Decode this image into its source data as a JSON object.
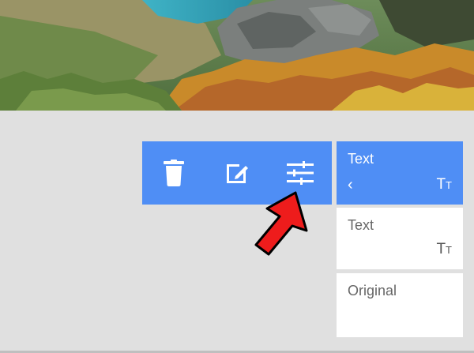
{
  "photo": {
    "icon": "landscape-photo"
  },
  "toolbar": {
    "color": "#4f8ef5",
    "buttons": [
      {
        "name": "delete",
        "icon": "trash-icon"
      },
      {
        "name": "edit",
        "icon": "edit-icon"
      },
      {
        "name": "adjust",
        "icon": "sliders-icon"
      }
    ]
  },
  "side_panel": {
    "cards": [
      {
        "title": "Text",
        "tt_big": "T",
        "tt_small": "T",
        "active": true
      },
      {
        "title": "Text",
        "tt_big": "T",
        "tt_small": "T",
        "active": false
      },
      {
        "title": "Original",
        "active": false
      }
    ],
    "back_glyph": "‹"
  },
  "colors": {
    "accent": "#4f8ef5",
    "annotation_arrow": "#ee1c1c"
  }
}
